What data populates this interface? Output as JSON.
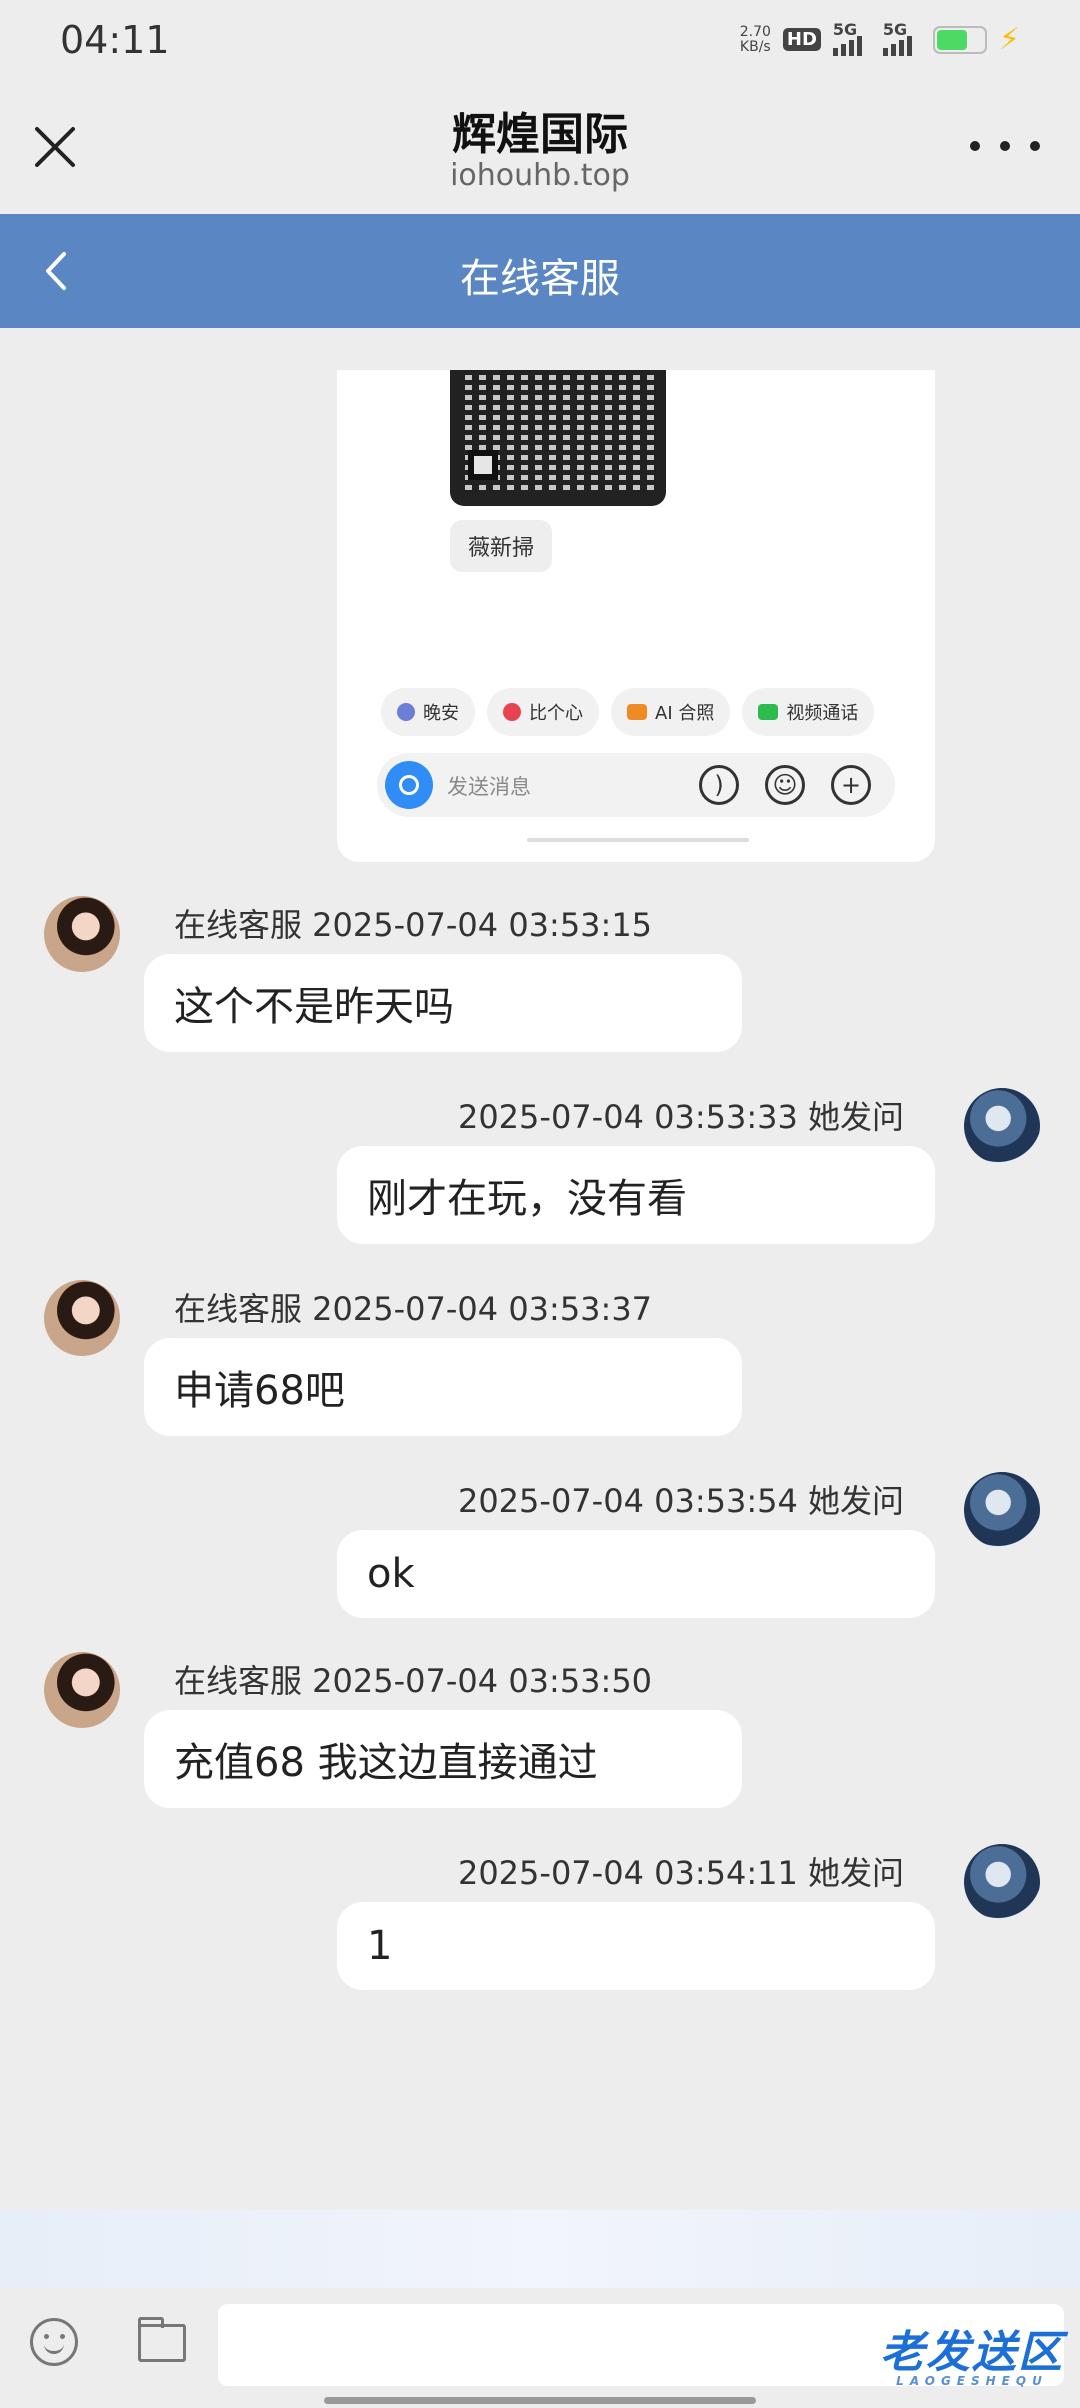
{
  "status_bar": {
    "time": "04:11",
    "net_speed_value": "2.70",
    "net_speed_unit": "KB/s",
    "hd_label": "HD",
    "signal_1": "5G",
    "signal_2": "5G",
    "battery_color": "#4cd964"
  },
  "title_bar": {
    "title": "辉煌国际",
    "url": "iohouhb.top",
    "close_icon": "close-icon",
    "more_icon": "more-dots-icon"
  },
  "chat_header": {
    "title": "在线客服",
    "back_icon": "chevron-left-icon",
    "color": "#5a87c3"
  },
  "image_card": {
    "qr_label": "薇新掃",
    "quick_replies": [
      "晚安",
      "比个心",
      "AI 合照",
      "视频通话"
    ],
    "input_placeholder": "发送消息"
  },
  "messages": [
    {
      "side": "agent",
      "meta": "在线客服 2025-07-04 03:53:15",
      "text": "这个不是昨天吗"
    },
    {
      "side": "user",
      "meta": "2025-07-04 03:53:33 她发问",
      "text": "刚才在玩，没有看"
    },
    {
      "side": "agent",
      "meta": "在线客服 2025-07-04 03:53:37",
      "text": "申请68吧"
    },
    {
      "side": "user",
      "meta": "2025-07-04 03:53:54 她发问",
      "text": "ok"
    },
    {
      "side": "agent",
      "meta": "在线客服 2025-07-04 03:53:50",
      "text": "充值68 我这边直接通过"
    },
    {
      "side": "user",
      "meta": "2025-07-04 03:54:11 她发问",
      "text": "1"
    }
  ],
  "bottom_bar": {
    "emoji_icon": "emoji-icon",
    "folder_icon": "folder-icon",
    "input_value": "",
    "watermark": "老发送区",
    "watermark_sub": "LAOGESHEQU"
  }
}
